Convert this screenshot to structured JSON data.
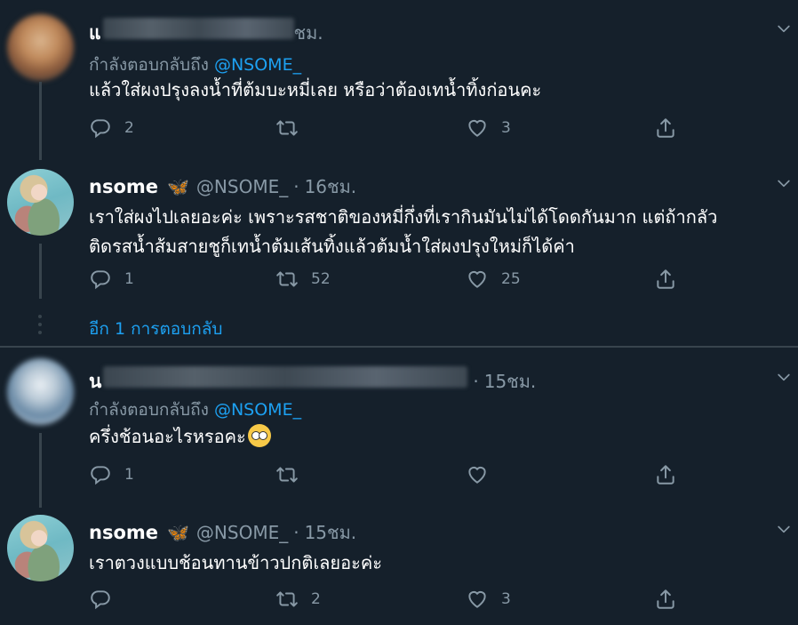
{
  "tweets": [
    {
      "name": "แ",
      "time": "ชม.",
      "replying_prefix": "กำลังตอบกลับถึง",
      "replying_to": "@NSOME_",
      "text_lines": [
        "แล้วใส่ผงปรุงลงน้ำที่ต้มบะหมี่เลย หรือว่าต้องเทน้ำทิ้งก่อนคะ"
      ],
      "reply_count": "2",
      "retweet_count": "",
      "like_count": "3"
    },
    {
      "name": "nsome",
      "badge": "🦋",
      "handle": "@NSOME_",
      "sep": "·",
      "time": "16ชม.",
      "text_lines": [
        "เราใส่ผงไปเลยอะค่ะ เพราะรสชาติของหมี่กึ่งที่เรากินมันไม่ได้โดดกันมาก แต่ถ้ากลัว",
        "ติดรสน้ำส้มสายชูก็เทน้ำต้มเส้นทิ้งแล้วต้มน้ำใส่ผงปรุงใหม่ก็ได้ค่า"
      ],
      "reply_count": "1",
      "retweet_count": "52",
      "like_count": "25"
    },
    {
      "name": "น",
      "sep": "·",
      "time": "15ชม.",
      "replying_prefix": "กำลังตอบกลับถึง",
      "replying_to": "@NSOME_",
      "text_lines": [
        "ครึ่งช้อนอะไรหรอคะ"
      ],
      "emoji": "face-with-rolling-eyes",
      "reply_count": "1",
      "retweet_count": "",
      "like_count": ""
    },
    {
      "name": "nsome",
      "badge": "🦋",
      "handle": "@NSOME_",
      "sep": "·",
      "time": "15ชม.",
      "text_lines": [
        "เราตวงแบบช้อนทานข้าวปกติเลยอะค่ะ"
      ],
      "reply_count": "",
      "retweet_count": "2",
      "like_count": "3"
    }
  ],
  "more_replies_label": "อีก 1 การตอบกลับ",
  "icons": {
    "reply": "reply-icon",
    "retweet": "retweet-icon",
    "like": "heart-icon",
    "share": "share-icon",
    "menu": "chevron-down-icon"
  },
  "colors": {
    "background": "#15202b",
    "muted": "#8899a6",
    "accent": "#1da1f2",
    "divider": "#38444d"
  }
}
